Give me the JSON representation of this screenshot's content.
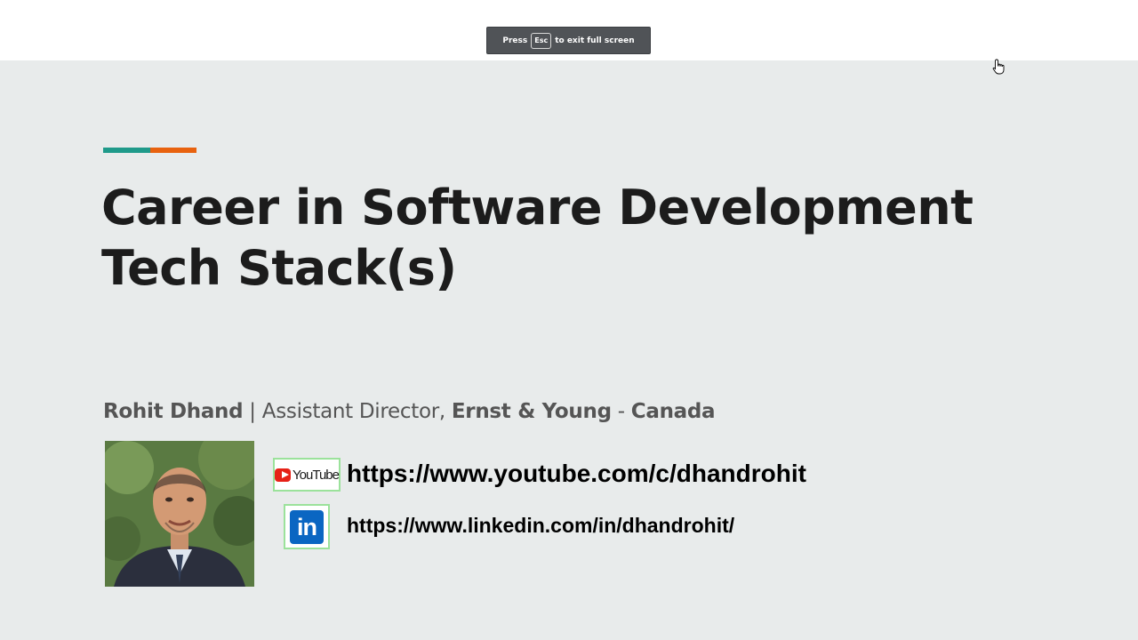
{
  "fullscreen_notice": {
    "press": "Press",
    "key": "Esc",
    "message": "to exit full screen"
  },
  "slide": {
    "accent_colors": [
      "#1f9a8a",
      "#e8620f"
    ],
    "title_line1": "Career in Software Development",
    "title_line2": "Tech Stack(s)",
    "presenter": {
      "name": "Rohit Dhand",
      "separator": " | ",
      "role": "Assistant Director, ",
      "company": "Ernst & Young",
      "dash": " - ",
      "country": "Canada"
    },
    "youtube": {
      "logo_text": "YouTube",
      "url": "https://www.youtube.com/c/dhandrohit"
    },
    "linkedin": {
      "logo_text": "in",
      "url": "https://www.linkedin.com/in/dhandrohit/"
    }
  }
}
